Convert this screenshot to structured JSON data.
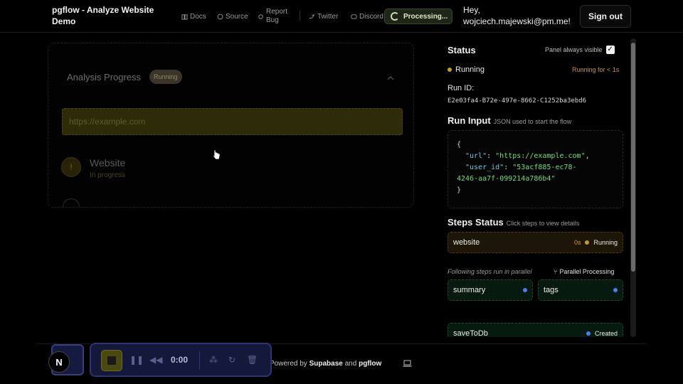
{
  "header": {
    "brand": "pgflow - Analyze Website Demo",
    "nav": [
      {
        "label": "Docs",
        "icon": "book-icon"
      },
      {
        "label": "Source",
        "icon": "github-icon"
      },
      {
        "label": "Report Bug",
        "icon": "bug-icon"
      },
      {
        "label": "Twitter",
        "icon": "twitter-icon"
      },
      {
        "label": "Discord",
        "icon": "discord-icon"
      }
    ],
    "processing_label": "Processing...",
    "greeting": "Hey,",
    "email": "wojciech.majewski@pm.me!",
    "sign_out": "Sign out"
  },
  "progress_card": {
    "title": "Analysis Progress",
    "badge": "Running",
    "url": "https://example.com",
    "step_name": "Website",
    "step_status": "In progress"
  },
  "status_panel": {
    "title": "Status",
    "panel_visible_label": "Panel always visible",
    "run_state": "Running",
    "run_duration": "Running for < 1s",
    "run_id_label": "Run ID:",
    "run_id": "E2e03fa4-B72e-497e-8662-C1252ba3ebd6",
    "run_input_label": "Run Input",
    "run_input_sub": "JSON used to start the flow",
    "run_input": {
      "open": "{",
      "url_key": "\"url\"",
      "url_val": "\"https://example.com\"",
      "user_id_key": "\"user_id\"",
      "user_id_val_1": "\"53acf885-ec78-",
      "user_id_val_2": "4246-aa7f-099214a786b4\"",
      "close": "}"
    },
    "steps_label": "Steps Status",
    "steps_sub": "Click steps to view details",
    "steps": {
      "website": {
        "name": "website",
        "time": "0s",
        "state": "Running"
      },
      "summary": {
        "name": "summary"
      },
      "tags": {
        "name": "tags"
      },
      "save": {
        "name": "saveToDb",
        "state": "Created"
      }
    },
    "parallel_note": "Following steps run in parallel",
    "parallel_label": "Parallel Processing"
  },
  "footer": {
    "powered_prefix": "Powered by",
    "supabase": "Supabase",
    "and": "and",
    "pgflow": "pgflow"
  },
  "player": {
    "timecode": "0:00",
    "logo_letter": "N"
  },
  "colors": {
    "running": "#c89a2a",
    "created": "#4a7ef0",
    "green_card": "#071a10"
  }
}
